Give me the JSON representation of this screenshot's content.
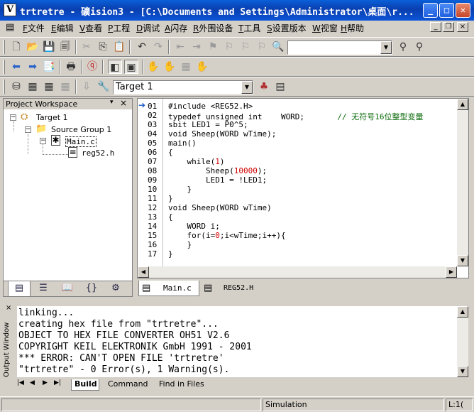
{
  "window": {
    "title": "trtretre  - 礦ision3 - [C:\\Documents and Settings\\Administrator\\桌面\\r...",
    "app_icon_letter": "V"
  },
  "menu": {
    "items": [
      {
        "key": "F",
        "label": "文件"
      },
      {
        "key": "E",
        "label": "编辑"
      },
      {
        "key": "V",
        "label": "查看"
      },
      {
        "key": "P",
        "label": "工程"
      },
      {
        "key": "D",
        "label": "调试"
      },
      {
        "key": "A",
        "label": "闪存"
      },
      {
        "key": "R",
        "label": "外围设备"
      },
      {
        "key": "T",
        "label": "工具"
      },
      {
        "key": "S",
        "label": "设置版本"
      },
      {
        "key": "W",
        "label": "视窗"
      },
      {
        "key": "H",
        "label": "帮助"
      }
    ]
  },
  "build_toolbar": {
    "target_value": "Target 1"
  },
  "find_combo": {
    "value": ""
  },
  "workspace": {
    "header": "Project Workspace",
    "tree": {
      "target": "Target 1",
      "group": "Source Group 1",
      "file1": "Main.c",
      "file2": "reg52.h"
    }
  },
  "editor": {
    "line_numbers": [
      "01",
      "02",
      "03",
      "04",
      "05",
      "06",
      "07",
      "08",
      "09",
      "10",
      "11",
      "12",
      "13",
      "14",
      "15",
      "16",
      "17"
    ],
    "tabs": [
      "Main.c",
      "REG52.H"
    ]
  },
  "output": {
    "label": "Output Window",
    "lines": [
      "linking...",
      "creating hex file from \"trtretre\"...",
      "OBJECT TO HEX FILE CONVERTER OH51 V2.6",
      "COPYRIGHT KEIL ELEKTRONIK GmbH 1991 - 2001",
      "*** ERROR: CAN'T OPEN FILE 'trtretre'",
      "\"trtretre\" - 0 Error(s), 1 Warning(s)."
    ],
    "tabs": [
      "Build",
      "Command",
      "Find in Files"
    ]
  },
  "status": {
    "mode": "Simulation",
    "position": "L:1("
  }
}
